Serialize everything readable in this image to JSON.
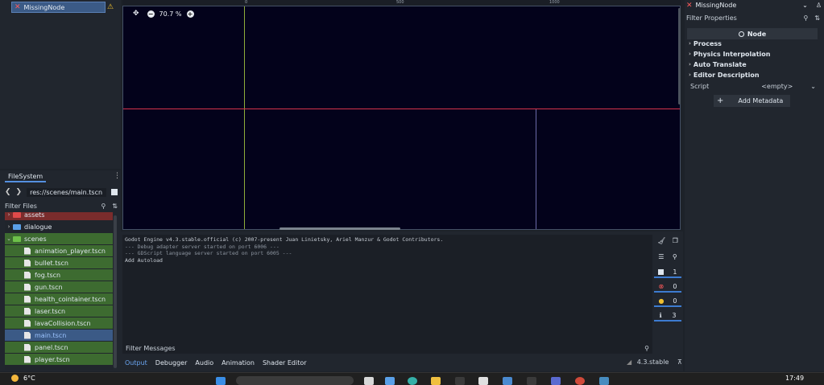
{
  "scene_tree": {
    "root_node": "MissingNode",
    "warning_icon": "warning-icon"
  },
  "filesystem": {
    "tab_label": "FileSystem",
    "path": "res://scenes/main.tscn",
    "filter_placeholder": "Filter Files",
    "items": [
      {
        "label": "assets",
        "type": "folder",
        "color": "#e04a4a"
      },
      {
        "label": "dialogue",
        "type": "folder",
        "color": "#5aa0e8"
      },
      {
        "label": "scenes",
        "type": "folder",
        "color": "#6ec04a"
      },
      {
        "label": "animation_player.tscn",
        "type": "file"
      },
      {
        "label": "bullet.tscn",
        "type": "file"
      },
      {
        "label": "fog.tscn",
        "type": "file"
      },
      {
        "label": "gun.tscn",
        "type": "file"
      },
      {
        "label": "health_cointainer.tscn",
        "type": "file"
      },
      {
        "label": "laser.tscn",
        "type": "file"
      },
      {
        "label": "lavaCollision.tscn",
        "type": "file"
      },
      {
        "label": "main.tscn",
        "type": "file"
      },
      {
        "label": "panel.tscn",
        "type": "file"
      },
      {
        "label": "player.tscn",
        "type": "file"
      }
    ]
  },
  "viewport": {
    "zoom": "70.7 %",
    "ruler_labels": [
      "0",
      "500",
      "1000"
    ],
    "colors": {
      "background": "#03021b",
      "x_axis": "#d4324a",
      "y_axis": "#8fae3a"
    }
  },
  "inspector": {
    "node_name": "MissingNode",
    "filter_placeholder": "Filter Properties",
    "class_header": "Node",
    "sections": [
      "Process",
      "Physics Interpolation",
      "Auto Translate",
      "Editor Description"
    ],
    "script_label": "Script",
    "script_value": "<empty>",
    "add_metadata": "Add Metadata"
  },
  "output": {
    "lines": [
      "Godot Engine v4.3.stable.official (c) 2007-present Juan Linietsky, Ariel Manzur & Godot Contributors.",
      "--- Debug adapter server started on port 6006 ---",
      "--- GDScript language server started on port 6005 ---",
      "Add Autoload"
    ],
    "counters": {
      "log": "1",
      "errors": "0",
      "warnings": "0",
      "info": "3"
    },
    "filter_placeholder": "Filter Messages"
  },
  "bottom_tabs": [
    "Output",
    "Debugger",
    "Audio",
    "Animation",
    "Shader Editor"
  ],
  "version": "4.3.stable",
  "taskbar": {
    "temperature": "6°C",
    "clock": "17:49"
  }
}
